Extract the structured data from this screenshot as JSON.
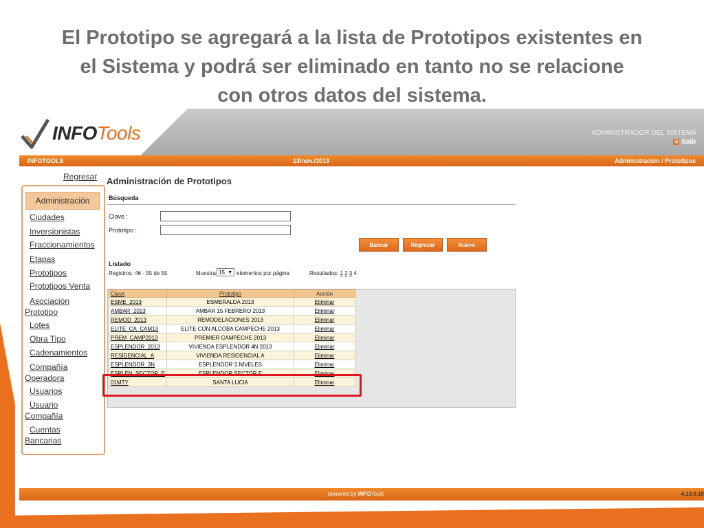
{
  "slide": {
    "title_lines": [
      "El Prototipo se agregará a la lista de Prototipos existentes en",
      "el Sistema y podrá ser eliminado en tanto no se relacione",
      "con otros datos del sistema."
    ]
  },
  "header": {
    "logo_bold": "INFO",
    "logo_light": "Tools",
    "user_role": "ADMINISTRADOR DEL SISTEMA",
    "logout_label": "Salir"
  },
  "topbar": {
    "app_name": "INFOTOOLS",
    "date": "13/nov./2013",
    "breadcrumb": "Administración / Prototipos"
  },
  "sidebar": {
    "back_label": "Regresar",
    "section_label": "Administración",
    "items": [
      {
        "label": "Ciudades"
      },
      {
        "label": "Inversionistas"
      },
      {
        "label": "Fraccionamientos"
      },
      {
        "label": "Etapas"
      },
      {
        "label": "Prototipos"
      },
      {
        "label": "Prototipos Venta"
      },
      {
        "line1": "Asociación",
        "line2": "Prototipo"
      },
      {
        "label": "Lotes"
      },
      {
        "label": "Obra Tipo"
      },
      {
        "label": "Cadenamientos"
      },
      {
        "line1": "Compañía",
        "line2": "Operadora"
      },
      {
        "label": "Usuarios"
      },
      {
        "line1": "Usuario",
        "line2": "Compañía"
      },
      {
        "line1": "Cuentas",
        "line2": "Bancarias"
      }
    ]
  },
  "main": {
    "title": "Administración de Prototipos",
    "search": {
      "section_label": "Búsqueda",
      "clave_label": "Clave :",
      "clave_value": "",
      "prototipo_label": "Prototipo :",
      "prototipo_value": ""
    },
    "buttons": {
      "search": "Buscar",
      "back": "Regresar",
      "new": "Nuevo"
    },
    "listing": {
      "section_label": "Listado",
      "records": "Registros: 46 - 55 de 55",
      "show_label": "Muestra",
      "page_size": "15",
      "per_page_label": "elementos por página",
      "results_label": "Resultados:",
      "pages": [
        "1",
        "2",
        "3"
      ],
      "current_page": "4"
    },
    "table": {
      "columns": [
        "Clave",
        "Prototipo",
        "Acción"
      ],
      "rows": [
        [
          "ESME_2013",
          "ESMERALDA 2013",
          "Eliminar"
        ],
        [
          "AMBAR_2013",
          "AMBAR 15 FEBRERO 2013",
          "Eliminar"
        ],
        [
          "REMOD_2013",
          "REMODELACIONES 2013",
          "Eliminar"
        ],
        [
          "ELITE_CA_CAM13",
          "ELITE CON ALCOBA CAMPECHE 2013",
          "Eliminar"
        ],
        [
          "PREM_CAMP2013",
          "PREMIER CAMPECHE 2013",
          "Eliminar"
        ],
        [
          "ESPLENDOR_2013",
          "VIVIENDA ESPLENDOR 4N 2013",
          "Eliminar"
        ],
        [
          "RESIDENCIAL_A",
          "VIVIENDA RESIDENCIAL A",
          "Eliminar"
        ],
        [
          "ESPLENDOR_3N",
          "ESPLENDOR 3 NIVELES",
          "Eliminar"
        ],
        [
          "ESPLEN_SECTOR_E",
          "ESPLENDOR SECTOR E",
          "Eliminar"
        ],
        [
          "01MTY",
          "SANTA LUCIA",
          "Eliminar"
        ]
      ]
    }
  },
  "footer": {
    "powered_label": "powered by",
    "brand_bold": "INFO",
    "brand_light": "Tools",
    "version": "4.13.9.10"
  },
  "colors": {
    "accent": "#e8701e",
    "highlight": "#e0141e",
    "header_gray": "#b5b5b5",
    "title_gray": "#6e6e6e"
  }
}
